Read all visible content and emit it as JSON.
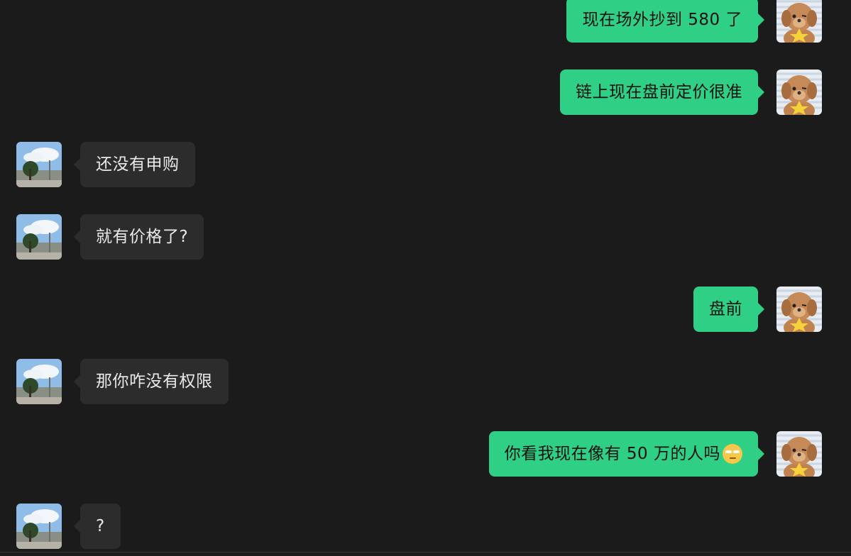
{
  "conversation": {
    "messages": [
      {
        "id": "m1",
        "direction": "out",
        "text": "现在场外抄到 580 了"
      },
      {
        "id": "m2",
        "direction": "out",
        "text": "链上现在盘前定价很准"
      },
      {
        "id": "m3",
        "direction": "in",
        "text": "还没有申购"
      },
      {
        "id": "m4",
        "direction": "in",
        "text": "就有价格了?"
      },
      {
        "id": "m5",
        "direction": "out",
        "text": "盘前"
      },
      {
        "id": "m6",
        "direction": "in",
        "text": "那你咋没有权限"
      },
      {
        "id": "m7",
        "direction": "out",
        "text": "你看我现在像有 50 万的人吗",
        "emoji": "rolling-eyes-emoji"
      },
      {
        "id": "m8",
        "direction": "in",
        "text": "?"
      }
    ]
  },
  "avatars": {
    "incoming": "landscape-sky-avatar",
    "outgoing": "puppy-avatar"
  },
  "colors": {
    "background": "#1b1b1b",
    "incoming_bubble": "#2c2c2c",
    "outgoing_bubble": "#2fcf86",
    "incoming_text": "#e9e9e9",
    "outgoing_text": "#111111"
  }
}
